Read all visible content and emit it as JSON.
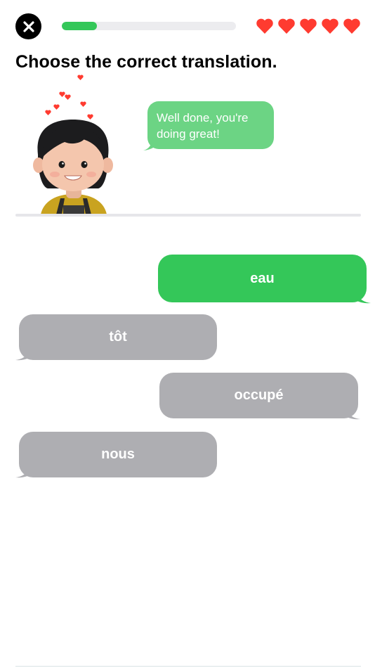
{
  "header": {
    "close_icon": "close-icon",
    "progress_fraction": 0.2,
    "hearts_count": 5,
    "heart_color": "#ff3b30",
    "accent_color": "#34c759"
  },
  "prompt": {
    "title": "Choose the correct translation."
  },
  "feedback": {
    "message": "Well done, you're doing great!",
    "bubble_color": "#6cd484"
  },
  "options": [
    {
      "label": "eau",
      "state": "selected",
      "color": "#34c759"
    },
    {
      "label": "tôt",
      "state": "default",
      "color": "#aeaeb2"
    },
    {
      "label": "occupé",
      "state": "default",
      "color": "#aeaeb2"
    },
    {
      "label": "nous",
      "state": "default",
      "color": "#aeaeb2"
    }
  ]
}
